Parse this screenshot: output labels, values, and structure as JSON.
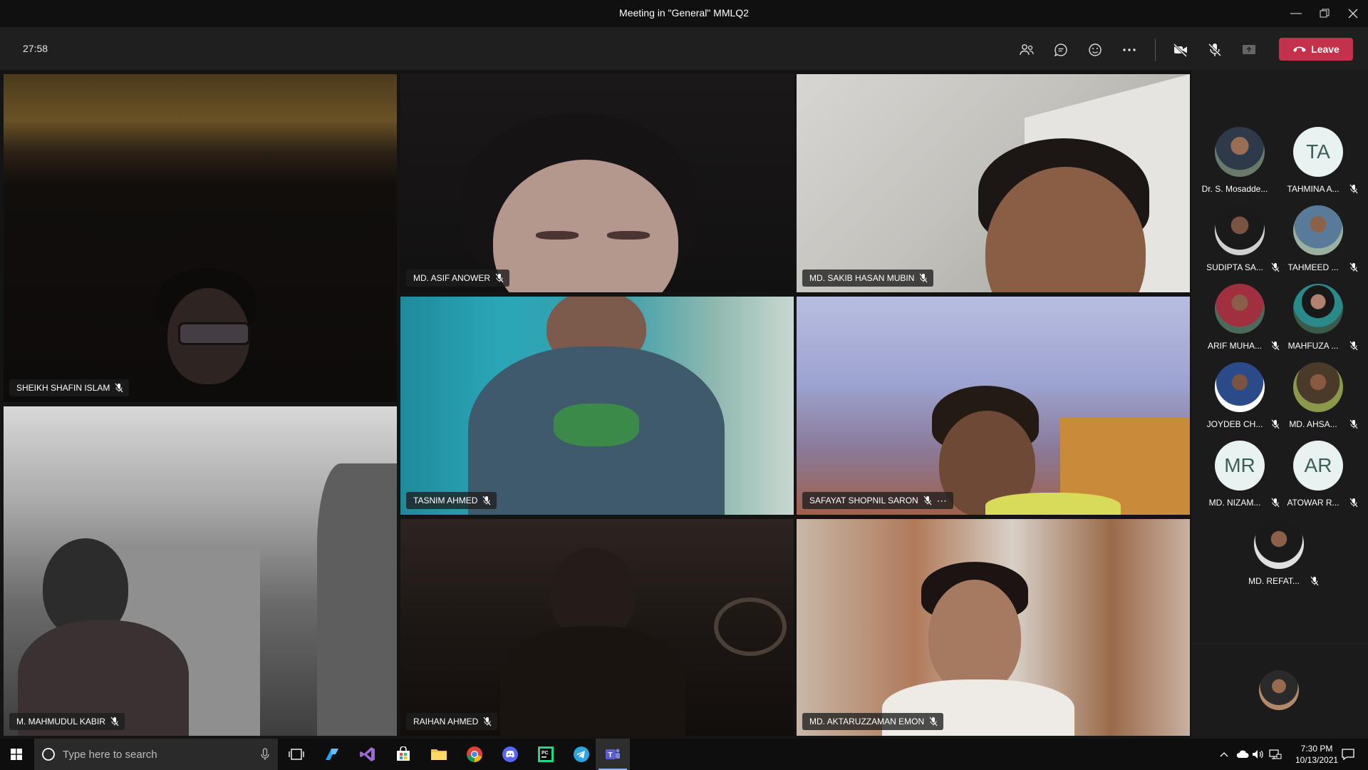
{
  "window": {
    "title": "Meeting in \"General\" MMLQ2"
  },
  "meeting": {
    "timer": "27:58",
    "leave_label": "Leave"
  },
  "video_tiles": [
    {
      "name": "SHEIKH SHAFIN ISLAM"
    },
    {
      "name": "MD. ASIF ANOWER"
    },
    {
      "name": "MD. SAKIB HASAN MUBIN"
    },
    {
      "name": "TASNIM AHMED"
    },
    {
      "name": "SAFAYAT SHOPNIL SARON"
    },
    {
      "name": "M. MAHMUDUL KABIR"
    },
    {
      "name": "RAIHAN AHMED"
    },
    {
      "name": "MD. AKTARUZZAMAN EMON"
    }
  ],
  "roster": [
    {
      "name": "Dr. S. Mosadde...",
      "initials": ""
    },
    {
      "name": "TAHMINA A...",
      "initials": "TA"
    },
    {
      "name": "SUDIPTA SA...",
      "initials": ""
    },
    {
      "name": "TAHMEED ...",
      "initials": ""
    },
    {
      "name": "ARIF MUHA...",
      "initials": ""
    },
    {
      "name": "MAHFUZA ...",
      "initials": ""
    },
    {
      "name": "JOYDEB CH...",
      "initials": ""
    },
    {
      "name": "MD. AHSA...",
      "initials": ""
    },
    {
      "name": "MD. NIZAM...",
      "initials": "MR"
    },
    {
      "name": "ATOWAR R...",
      "initials": "AR"
    },
    {
      "name": "MD. REFAT...",
      "initials": ""
    }
  ],
  "taskbar": {
    "search_placeholder": "Type here to search",
    "time": "7:30 PM",
    "date": "10/13/2021"
  },
  "colors": {
    "leave": "#c4314b",
    "initials_bg": "#e8f3f1",
    "initials_fg": "#3e5e59"
  }
}
